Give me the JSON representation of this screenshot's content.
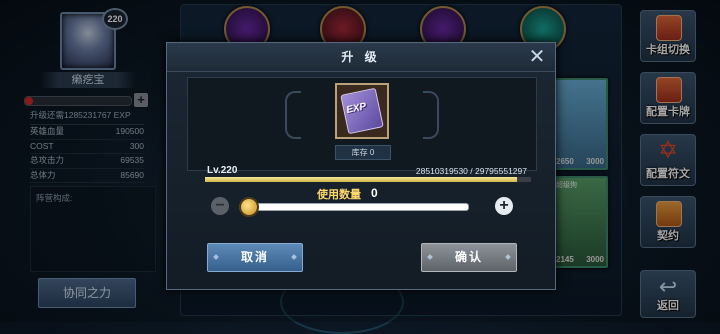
{
  "player": {
    "level": "220",
    "name": "癞疙宝",
    "exp_to_next": "升级还需1285231767 EXP",
    "exp_fill_fraction": 0.08,
    "exp_plus": "+",
    "stats": [
      {
        "label": "英雄血量",
        "value": "190500"
      },
      {
        "label": "COST",
        "value": "300"
      },
      {
        "label": "总攻击力",
        "value": "69535"
      },
      {
        "label": "总体力",
        "value": "85690"
      }
    ],
    "lineup_label": "阵营构成:",
    "collab_button": "协同之力"
  },
  "deck": {
    "card_stats": [
      {
        "atk": "2650",
        "hp": "3000"
      },
      {
        "atk": "2145",
        "hp": "3000"
      }
    ],
    "card_label": "超级狗"
  },
  "menu": {
    "items": [
      {
        "label": "卡组切换",
        "icon": "cards-icon"
      },
      {
        "label": "配置卡牌",
        "icon": "card-config-icon"
      },
      {
        "label": "配置符文",
        "icon": "rune-star-icon"
      },
      {
        "label": "契约",
        "icon": "scroll-icon"
      }
    ],
    "back_label": "返回"
  },
  "modal": {
    "title": "升 级",
    "close_icon": "close-icon",
    "item_name": "EXP",
    "stock": "库存 0",
    "level_label": "Lv.220",
    "exp_progress": "28510319530 / 29795551297",
    "exp_fraction": 0.957,
    "quantity_label": "使用数量",
    "quantity_value": "0",
    "minus": "−",
    "plus": "+",
    "cancel_button": "取消",
    "confirm_button": "确认"
  },
  "colors": {
    "accent_gold": "#d2b649",
    "cancel_blue": "#36608c",
    "confirm_gray": "#5e636a",
    "exp_red": "#d9282a"
  }
}
